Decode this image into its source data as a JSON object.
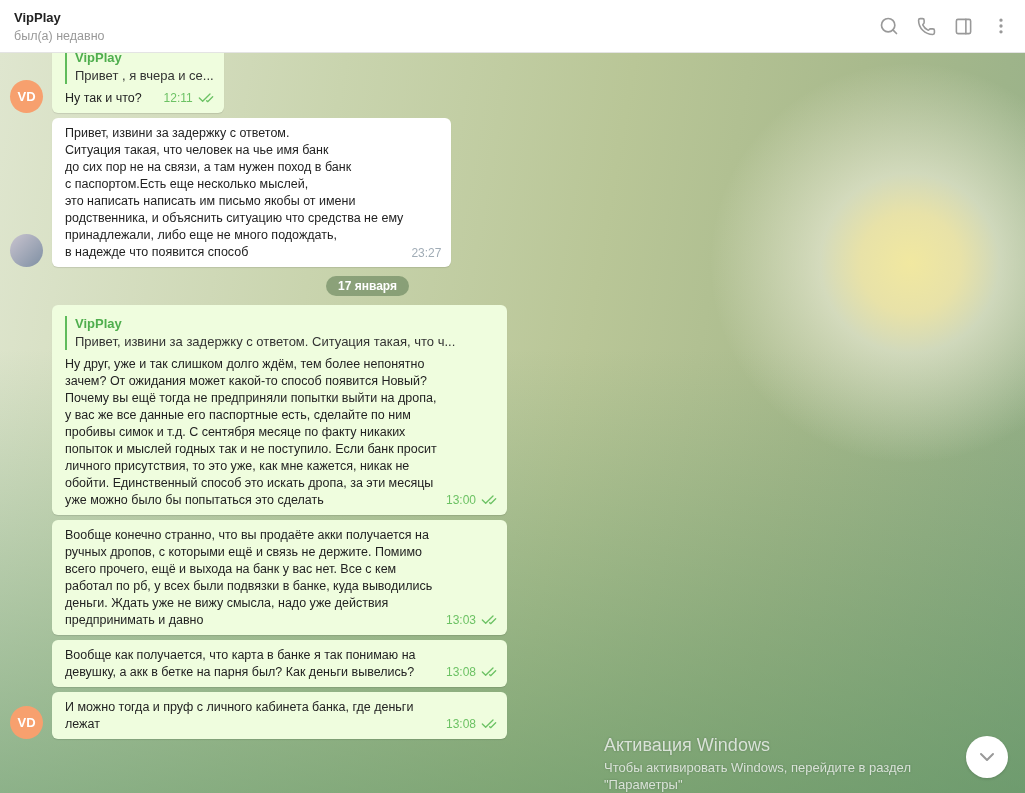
{
  "header": {
    "title": "VipPlay",
    "status": "был(а) недавно"
  },
  "feed": [
    {
      "kind": "group",
      "avatar": {
        "kind": "initials",
        "text": "VD"
      },
      "messages": [
        {
          "outgoing": true,
          "reply": {
            "author": "VipPlay",
            "text": "Привет  , я вчера и се..."
          },
          "text": "Ну так и что?",
          "time": "12:11",
          "read": true
        }
      ]
    },
    {
      "kind": "group",
      "avatar": {
        "kind": "photo"
      },
      "messages": [
        {
          "outgoing": false,
          "text": "Привет, извини за задержку с ответом.\nСитуация такая, что человек на чье имя банк\nдо сих пор не на связи, а там нужен поход в банк\nс паспортом.Есть еще несколько мыслей,\nэто написать написать им письмо якобы от имени\nродственника, и объяснить ситуацию что средства не ему\nпринадлежали, либо еще не много подождать,\nв надежде что появится способ",
          "time": "23:27"
        }
      ]
    },
    {
      "kind": "date",
      "text": "17 января"
    },
    {
      "kind": "group",
      "avatar": {
        "kind": "initials",
        "text": "VD"
      },
      "messages": [
        {
          "outgoing": true,
          "reply": {
            "author": "VipPlay",
            "text": "Привет, извини за задержку с ответом. Ситуация такая, что ч..."
          },
          "text": "Ну друг, уже и так слишком долго ждём, тем более непонятно зачем? От ожидания может какой-то способ появится Новый? Почему вы ещё тогда не предприняли попытки выйти на дропа, у вас же все данные его паспортные есть, сделайте по ним пробивы симок и т.д. С сентября месяце по факту никаких попыток и мыслей годных так и не поступило. Если банк просит личного присутствия, то это уже, как мне кажется, никак не обойти. Единственный способ это искать дропа, за эти месяцы уже можно было бы попытаться это сделать",
          "time": "13:00",
          "read": true
        },
        {
          "outgoing": true,
          "text": "Вообще конечно странно, что вы продаёте акки получается на ручных дропов, с которыми ещё и связь не держите. Помимо всего прочего, ещё и выхода на банк у вас нет. Все с кем работал по рб, у всех были подвязки в банке, куда выводились деньги. Ждать уже не вижу смысла, надо уже действия предпринимать и давно",
          "time": "13:03",
          "read": true
        },
        {
          "outgoing": true,
          "text": "Вообще как получается, что карта в банке я так понимаю на девушку, а акк в бетке на парня был? Как деньги вывелись?",
          "time": "13:08",
          "read": true
        },
        {
          "outgoing": true,
          "text": "И можно тогда и пруф с личного кабинета банка, где деньги лежат",
          "time": "13:08",
          "read": true
        }
      ]
    }
  ],
  "activation": {
    "title": "Активация Windows",
    "text": "Чтобы активировать Windows, перейдите в раздел \"Параметры\""
  }
}
